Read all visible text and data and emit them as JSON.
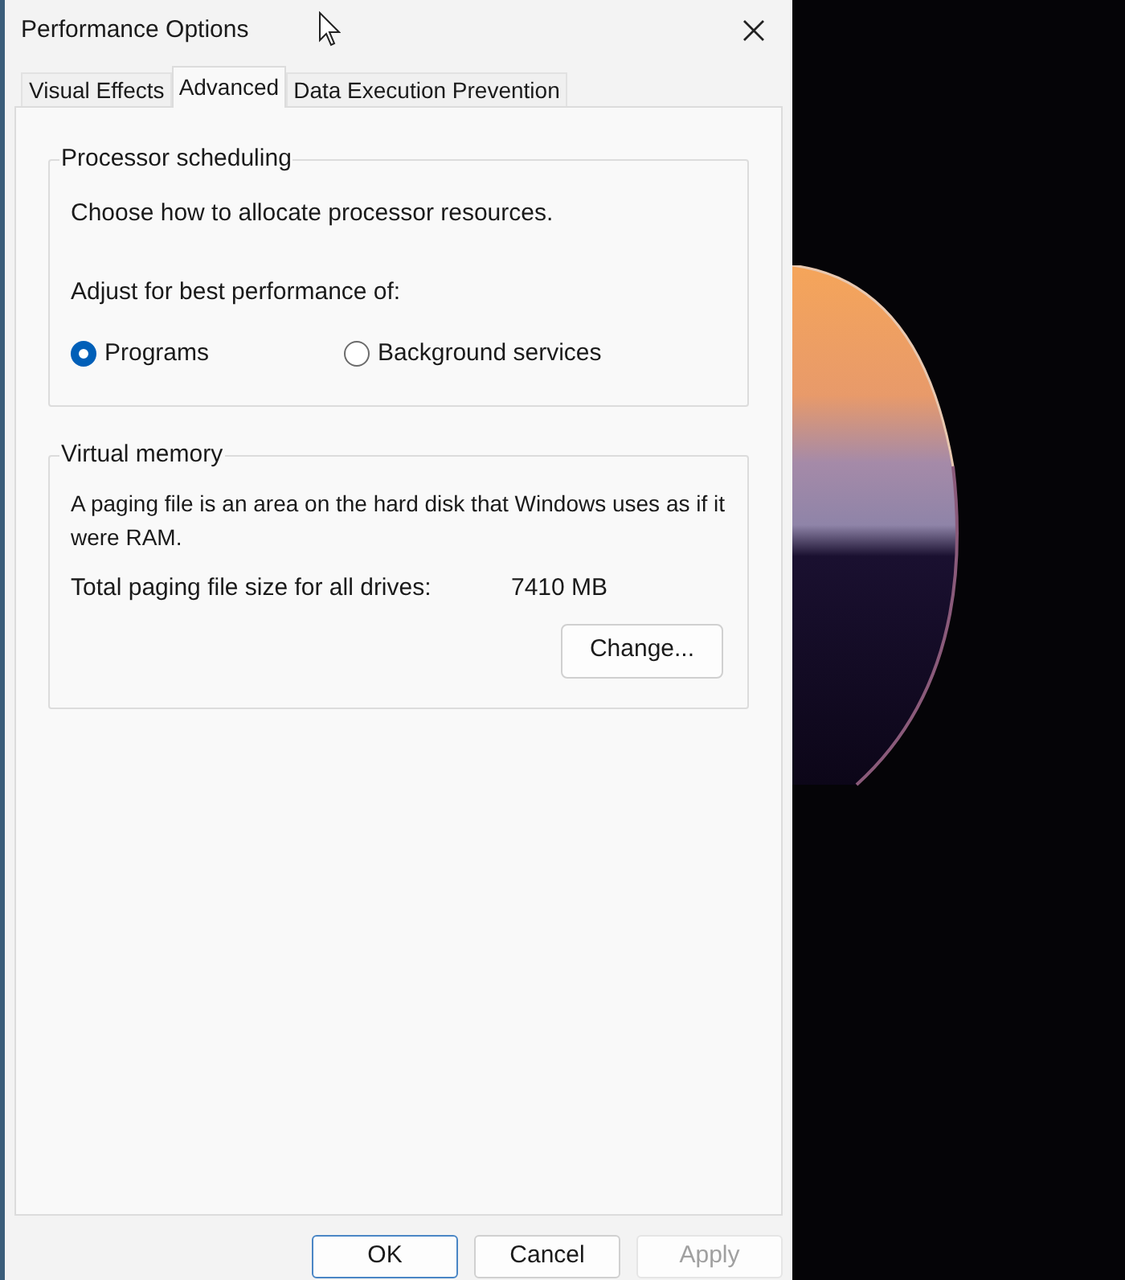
{
  "window": {
    "title": "Performance Options"
  },
  "tabs": [
    {
      "label": "Visual Effects",
      "selected": false
    },
    {
      "label": "Advanced",
      "selected": true
    },
    {
      "label": "Data Execution Prevention",
      "selected": false
    }
  ],
  "processor_scheduling": {
    "title": "Processor scheduling",
    "description": "Choose how to allocate processor resources.",
    "prompt": "Adjust for best performance of:",
    "options": [
      {
        "label": "Programs",
        "selected": true
      },
      {
        "label": "Background services",
        "selected": false
      }
    ]
  },
  "virtual_memory": {
    "title": "Virtual memory",
    "description": "A paging file is an area on the hard disk that Windows uses as if it were RAM.",
    "total_label": "Total paging file size for all drives:",
    "total_value": "7410 MB",
    "change_button": "Change..."
  },
  "buttons": [
    {
      "label": "OK",
      "default": true,
      "disabled": false
    },
    {
      "label": "Cancel",
      "default": false,
      "disabled": false
    },
    {
      "label": "Apply",
      "default": false,
      "disabled": true
    }
  ]
}
